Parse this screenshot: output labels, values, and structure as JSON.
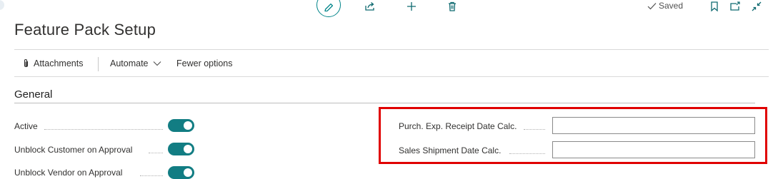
{
  "topbar": {
    "edit_icon": "pencil-icon",
    "share_icon": "share-icon",
    "new_icon": "plus-icon",
    "delete_icon": "trash-icon",
    "saved_label": "Saved",
    "bookmark_icon": "bookmark-icon",
    "open_new_window_icon": "open-new-window-icon",
    "collapse_icon": "collapse-icon"
  },
  "page": {
    "title": "Feature Pack Setup"
  },
  "actions": {
    "attachments_label": "Attachments",
    "automate_label": "Automate",
    "fewer_options_label": "Fewer options"
  },
  "general": {
    "title": "General",
    "left_fields": [
      {
        "label": "Active",
        "value": true
      },
      {
        "label": "Unblock Customer on Approval",
        "value": true
      },
      {
        "label": "Unblock Vendor on Approval",
        "value": true
      }
    ],
    "right_fields": [
      {
        "label": "Purch. Exp. Receipt Date Calc.",
        "value": ""
      },
      {
        "label": "Sales Shipment Date Calc.",
        "value": ""
      }
    ]
  },
  "colors": {
    "accent": "#127d83",
    "highlight": "#e00000"
  }
}
